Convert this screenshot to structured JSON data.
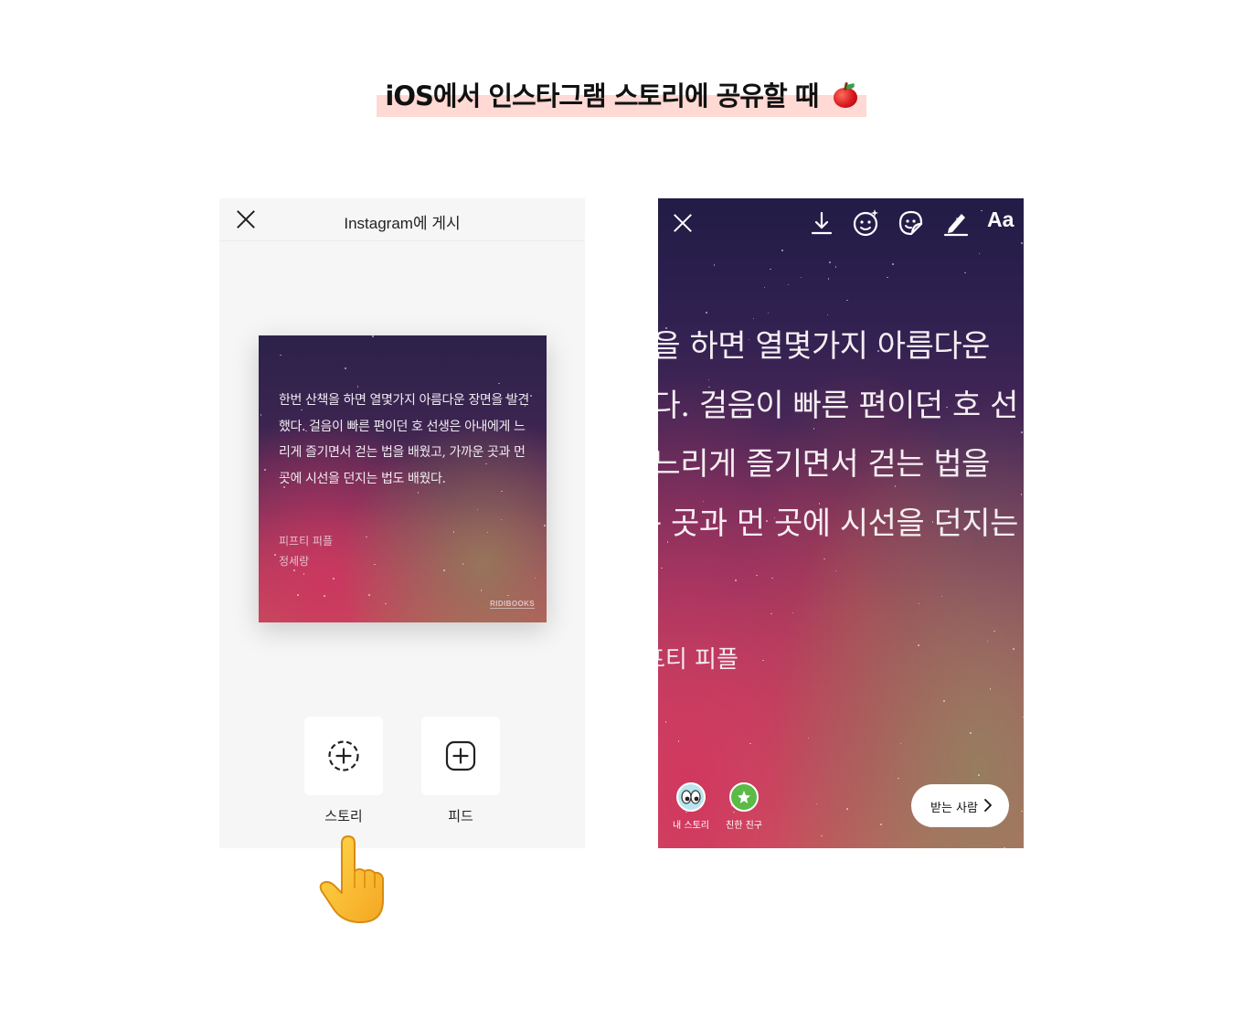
{
  "heading": {
    "text": "iOS에서 인스타그램 스토리에 공유할 때",
    "emoji_icon": "apple-icon"
  },
  "left_screen": {
    "title": "Instagram에 게시",
    "card": {
      "quote": "한번 산책을 하면 열몇가지 아름다운 장면을 발견했다. 걸음이 빠른 편이던 호 선생은 아내에게 느리게 즐기면서 걷는 법을 배웠고, 가까운 곳과 먼 곳에 시선을 던지는 법도 배웠다.",
      "book_title": "피프티 피플",
      "author": "정세랑",
      "logo": "RIDIBOOKS"
    },
    "buttons": {
      "story_label": "스토리",
      "feed_label": "피드"
    }
  },
  "right_screen": {
    "toolbar": {
      "icons": [
        "close-icon",
        "download-icon",
        "face-filter-icon",
        "sticker-icon",
        "draw-icon"
      ],
      "text_tool_label": "Aa"
    },
    "quote_lines": [
      "한번 산책을 하면 열몇가지 아름다운",
      "을 발견했다. 걸음이 빠른 편이던 호 선",
      "아내에게 느리게 즐기면서 걷는 법을",
      "고, 가까운 곳과 먼 곳에 시선을 던지는"
    ],
    "meta_text": "피프티 피플",
    "bottom": {
      "my_story_label": "내 스토리",
      "close_friends_label": "친한 친구",
      "send_label": "받는 사람"
    }
  },
  "colors": {
    "heading_highlight": "#ffd9d3",
    "left_bg": "#f6f6f6",
    "close_friends_green": "#5cba47"
  }
}
